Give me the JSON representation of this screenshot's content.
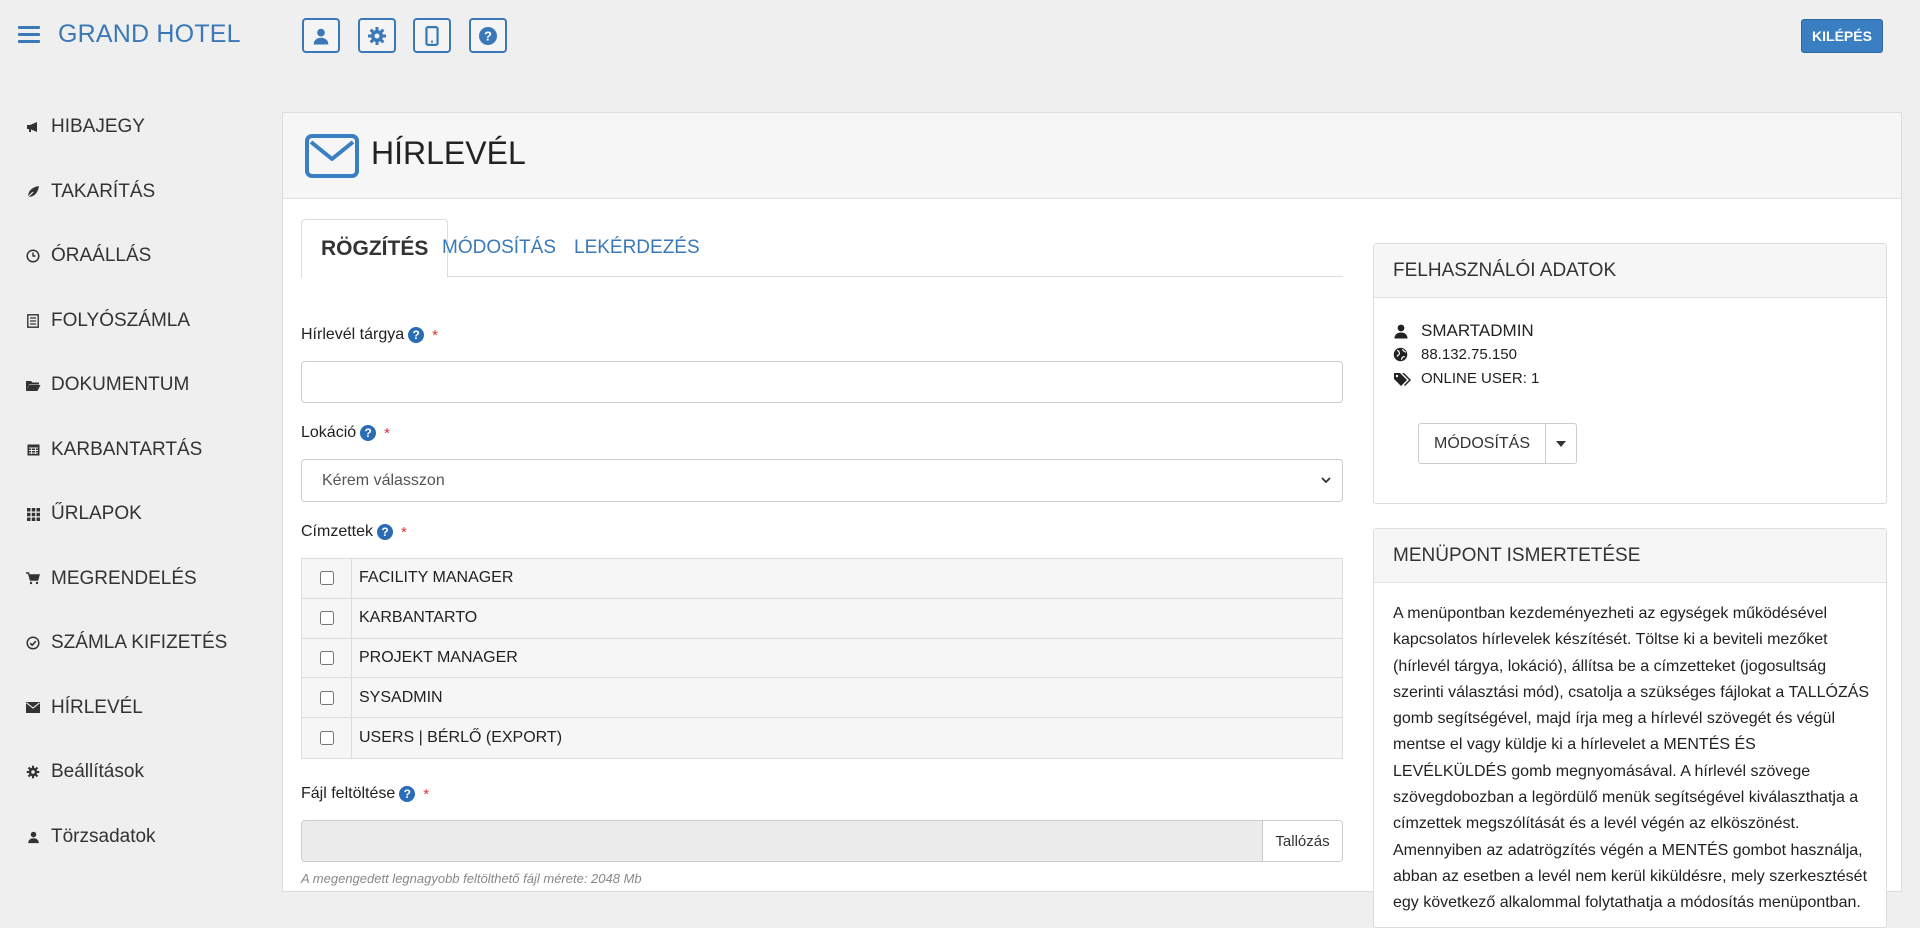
{
  "header": {
    "brand": "GRAND HOTEL",
    "logout_label": "KILÉPÉS",
    "buttons": [
      {
        "icon": "user-icon"
      },
      {
        "icon": "gear-icon"
      },
      {
        "icon": "mobile-icon"
      },
      {
        "icon": "help-circle-icon"
      }
    ]
  },
  "sidebar": {
    "items": [
      {
        "label": "HIBAJEGY",
        "icon": "megaphone-icon"
      },
      {
        "label": "TAKARÍTÁS",
        "icon": "leaf-icon"
      },
      {
        "label": "ÓRAÁLLÁS",
        "icon": "clock-icon"
      },
      {
        "label": "FOLYÓSZÁMLA",
        "icon": "list-icon"
      },
      {
        "label": "DOKUMENTUM",
        "icon": "folder-open-icon"
      },
      {
        "label": "KARBANTARTÁS",
        "icon": "calendar-icon"
      },
      {
        "label": "ŰRLAPOK",
        "icon": "grid-icon"
      },
      {
        "label": "MEGRENDELÉS",
        "icon": "cart-icon"
      },
      {
        "label": "SZÁMLA KIFIZETÉS",
        "icon": "check-circle-icon"
      },
      {
        "label": "HÍRLEVÉL",
        "icon": "envelope-icon"
      },
      {
        "label": "Beállítások",
        "icon": "gear-icon"
      },
      {
        "label": "Törzsadatok",
        "icon": "user-icon"
      }
    ]
  },
  "page": {
    "title": "HÍRLEVÉL",
    "tabs": [
      {
        "label": "RÖGZÍTÉS",
        "active": true
      },
      {
        "label": "MÓDOSÍTÁS",
        "active": false
      },
      {
        "label": "LEKÉRDEZÉS",
        "active": false
      }
    ]
  },
  "form": {
    "subject_label": "Hírlevél tárgya",
    "subject_value": "",
    "location_label": "Lokáció",
    "location_selected": "Kérem válasszon",
    "recipients_label": "Címzettek",
    "recipients": [
      {
        "label": "FACILITY MANAGER",
        "checked": false
      },
      {
        "label": "KARBANTARTO",
        "checked": false
      },
      {
        "label": "PROJEKT MANAGER",
        "checked": false
      },
      {
        "label": "SYSADMIN",
        "checked": false
      },
      {
        "label": "USERS | BÉRLŐ (EXPORT)",
        "checked": false
      }
    ],
    "file_label": "Fájl feltöltése",
    "browse_label": "Tallózás",
    "file_hint": "A megengedett legnagyobb feltölthető fájl mérete: 2048 Mb",
    "required_mark": "*",
    "help_mark": "?"
  },
  "user_card": {
    "title": "FELHASZNÁLÓI ADATOK",
    "username": "SMARTADMIN",
    "ip": "88.132.75.150",
    "online": "ONLINE USER: 1",
    "modify_label": "MÓDOSÍTÁS"
  },
  "menu_card": {
    "title": "MENÜPONT ISMERTETÉSE",
    "description": "A menüpontban kezdeményezheti az egységek működésével kapcsolatos hírlevelek készítését. Töltse ki a beviteli mezőket (hírlevél tárgya, lokáció), állítsa be a címzetteket (jogosultság szerinti választási mód), csatolja a szükséges fájlokat a TALLÓZÁS gomb segítségével, majd írja meg a hírlevél szövegét és végül mentse el vagy küldje ki a hírlevelet a MENTÉS ÉS LEVÉLKÜLDÉS gomb megnyomásával. A hírlevél szövege szövegdobozban a legördülő menük segítségével kiválaszthatja a címzettek megszólítását és a levél végén az elköszönést. Amennyiben az adatrögzítés végén a MENTÉS gombot használja, abban az esetben a levél nem kerül kiküldésre, mely szerkesztését egy következő alkalommal folytathatja a módosítás menüpontban."
  },
  "colors": {
    "accent": "#3a78b8",
    "logout_bg": "#3a7fc1",
    "help_bg": "#2a6db5",
    "required": "#dd3333"
  }
}
